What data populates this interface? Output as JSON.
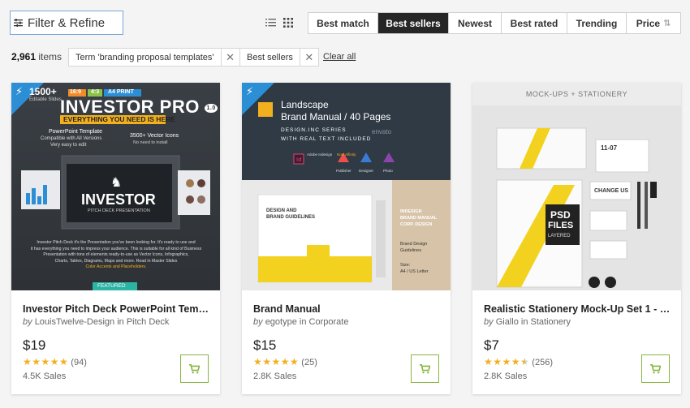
{
  "toolbar": {
    "filter_label": "Filter & Refine",
    "sort_options": [
      {
        "label": "Best match"
      },
      {
        "label": "Best sellers"
      },
      {
        "label": "Newest"
      },
      {
        "label": "Best rated"
      },
      {
        "label": "Trending"
      },
      {
        "label": "Price"
      }
    ],
    "active_sort": "Best sellers"
  },
  "results": {
    "count": "2,961",
    "count_suffix": "items",
    "chips": [
      {
        "label": "Term 'branding proposal templates'"
      },
      {
        "label": "Best sellers"
      }
    ],
    "clear_label": "Clear all"
  },
  "products": [
    {
      "title": "Investor Pitch Deck PowerPoint Templ...",
      "by": "by",
      "author": "LouisTwelve-Design",
      "in": "in",
      "category": "Pitch Deck",
      "price": "$19",
      "rating": 5,
      "reviews": "(94)",
      "sales": "4.5K Sales",
      "thumb": {
        "badges": [
          "16:9",
          "4:3",
          "A4 PRINT"
        ],
        "number": "1500+",
        "small": "Editable Slides",
        "brand": "INVESTOR PRO",
        "version": "1.0",
        "tagline": "EVERYTHING YOU NEED IS HERE",
        "ppt_line": "PowerPoint Template",
        "compat": "Compatible with All Versions",
        "edit": "Very easy to edit",
        "vec": "3500+ Vector Icons",
        "vec_sub": "No need to install",
        "big": "INVESTOR",
        "sub": "PITCH DECK PRESENTATION",
        "blurb_lines": [
          "Investor Pitch Deck it's the Presentation you've been looking for. It's ready to use and",
          "it has everything you need to impress your audience. This is suitable for all kind of Business",
          "Presentation with tons of elements ready-to-use as Vector Icons, Infographics,",
          "Charts, Tables, Diagrams, Maps and more. Read in Master Slides",
          "Color Accents and Placeholders."
        ],
        "featured": "FEATURED"
      }
    },
    {
      "title": "Brand Manual",
      "by": "by",
      "author": "egotype",
      "in": "in",
      "category": "Corporate",
      "price": "$15",
      "rating": 5,
      "reviews": "(25)",
      "sales": "2.8K Sales",
      "thumb": {
        "line1": "Landscape",
        "line2": "Brand Manual / 40 Pages",
        "series1": "DESIGN.INC SERIES",
        "series2": "WITH REAL TEXT INCLUDED",
        "apps": [
          "Adobe Indesign",
          "Now Affinity",
          "Publisher",
          "Designer",
          "Photo"
        ],
        "book_title_1": "DESIGN AND",
        "book_title_2": "BRAND GUIDELINES",
        "side_1": "INDESIGN",
        "side_2": "BRAND MANUAL",
        "side_3": "CORP. DESIGN",
        "side_4": "Brand Design",
        "side_5": "Guidelines",
        "size_label": "Size:",
        "size_value": "A4 / US Letter",
        "watermark": "envato"
      }
    },
    {
      "title": "Realistic Stationery Mock-Up Set 1 - C...",
      "by": "by",
      "author": "Giallo",
      "in": "in",
      "category": "Stationery",
      "price": "$7",
      "rating": 4.5,
      "reviews": "(256)",
      "sales": "2.8K Sales",
      "thumb": {
        "header": "MOCK-UPS + STATIONERY",
        "card_num": "11-07",
        "change": "CHANGE US",
        "psd1": "PSD",
        "psd2": "FILES",
        "psd3": "LAYERED"
      }
    }
  ],
  "colors": {
    "accent_blue": "#2c8fd6",
    "cart_green": "#87b540",
    "star": "#f2b01e",
    "active_sort_bg": "#262626"
  }
}
